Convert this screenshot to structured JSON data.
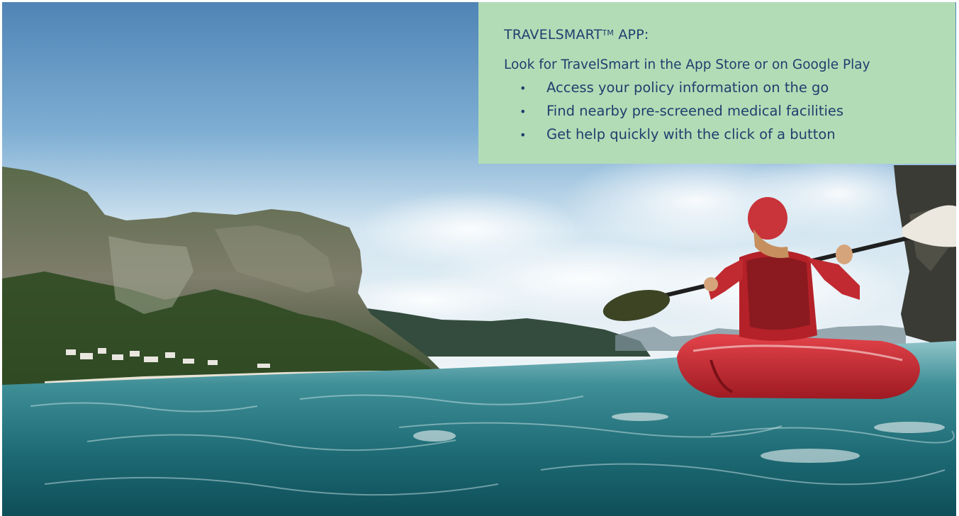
{
  "panel": {
    "title": "TRAVELSMART",
    "title_mark": "TM",
    "title_suffix": " APP:",
    "subtitle": "Look for TravelSmart in the App Store or on Google Play",
    "bullet_glyph": "•",
    "features": [
      "Access your policy information on the go",
      "Find nearby pre-screened medical facilities",
      "Get help quickly with the click of a button"
    ]
  },
  "colors": {
    "panel_background": "#b2dcb6",
    "panel_text": "#1e3f6e",
    "kayak_red": "#c8262e"
  },
  "photo": {
    "subject": "kayak-photo"
  }
}
